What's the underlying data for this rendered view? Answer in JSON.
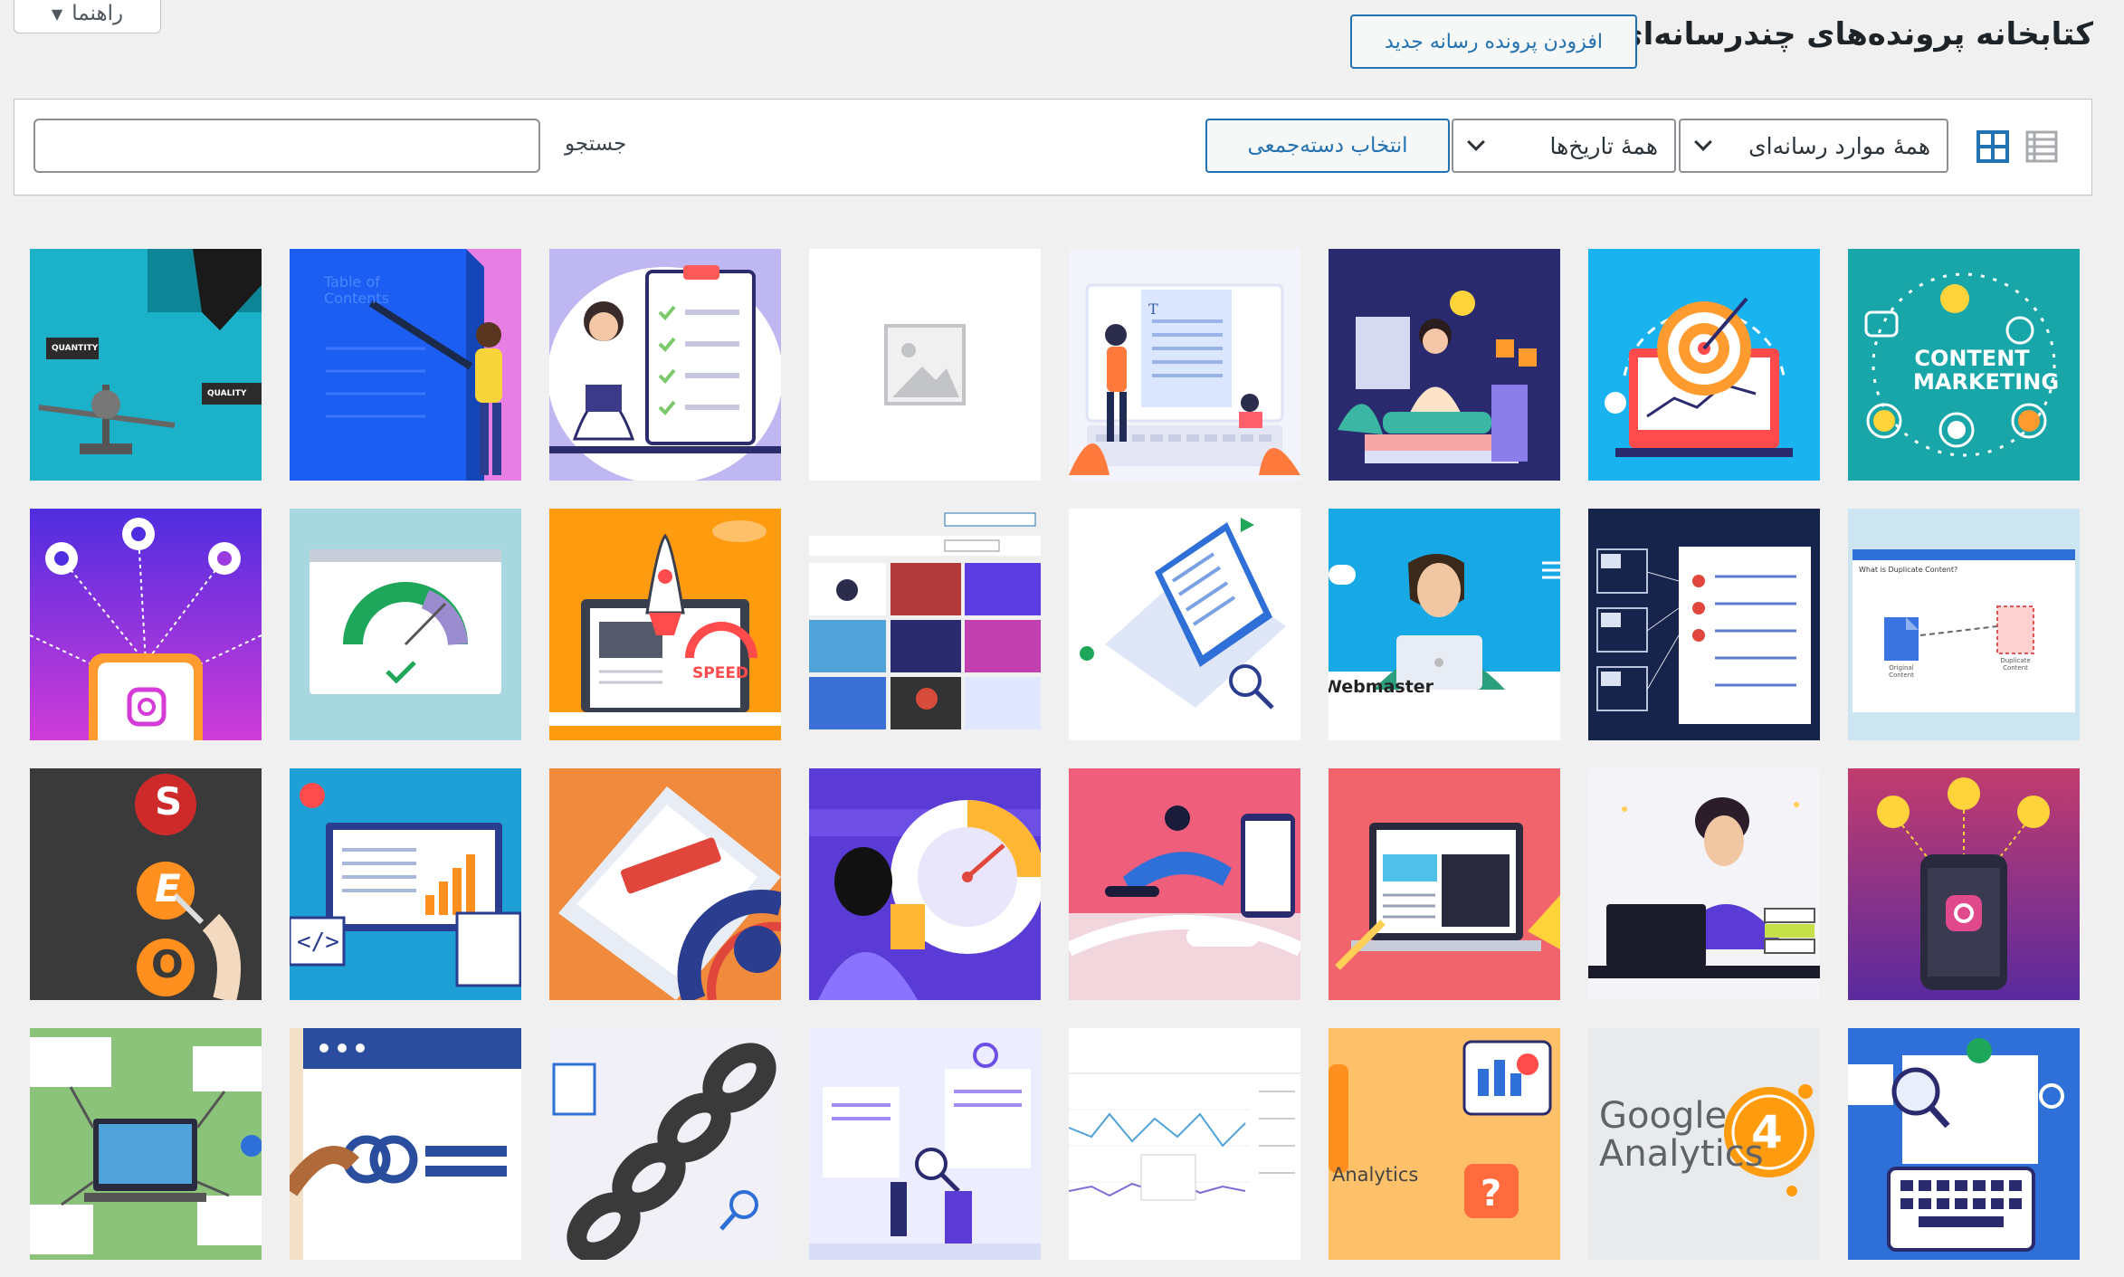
{
  "header": {
    "help_label": "راهنما",
    "title": "کتابخانه پرونده‌های چندرسانه‌ای",
    "add_new_label": "افزودن پرونده رسانه جدید"
  },
  "toolbar": {
    "media_type_filter": "همهٔ موارد رسانه‌ای",
    "date_filter": "همهٔ تاریخ‌ها",
    "bulk_select_label": "انتخاب دسته‌جمعی",
    "search_label": "جستجو",
    "search_value": ""
  },
  "thumbs": {
    "quantity": "QUANTITY",
    "quality": "QUALITY",
    "toc_line1": "Table of",
    "toc_line2": "Contents",
    "content": "CONTENT",
    "marketing": "MARKETING",
    "speed": "SPEED",
    "webmaster": "Webmaster",
    "duplicate_title": "What is Duplicate Content?",
    "original": "Original Content",
    "duplicate": "Duplicate Content",
    "analytics": "Analytics",
    "google": "Google",
    "analytics_big": "Analytics",
    "ga_version": "4",
    "seo_s": "S",
    "seo_e": "E",
    "seo_o": "O"
  },
  "colors": {
    "accent": "#2271b1",
    "background": "#f0f0f1"
  }
}
